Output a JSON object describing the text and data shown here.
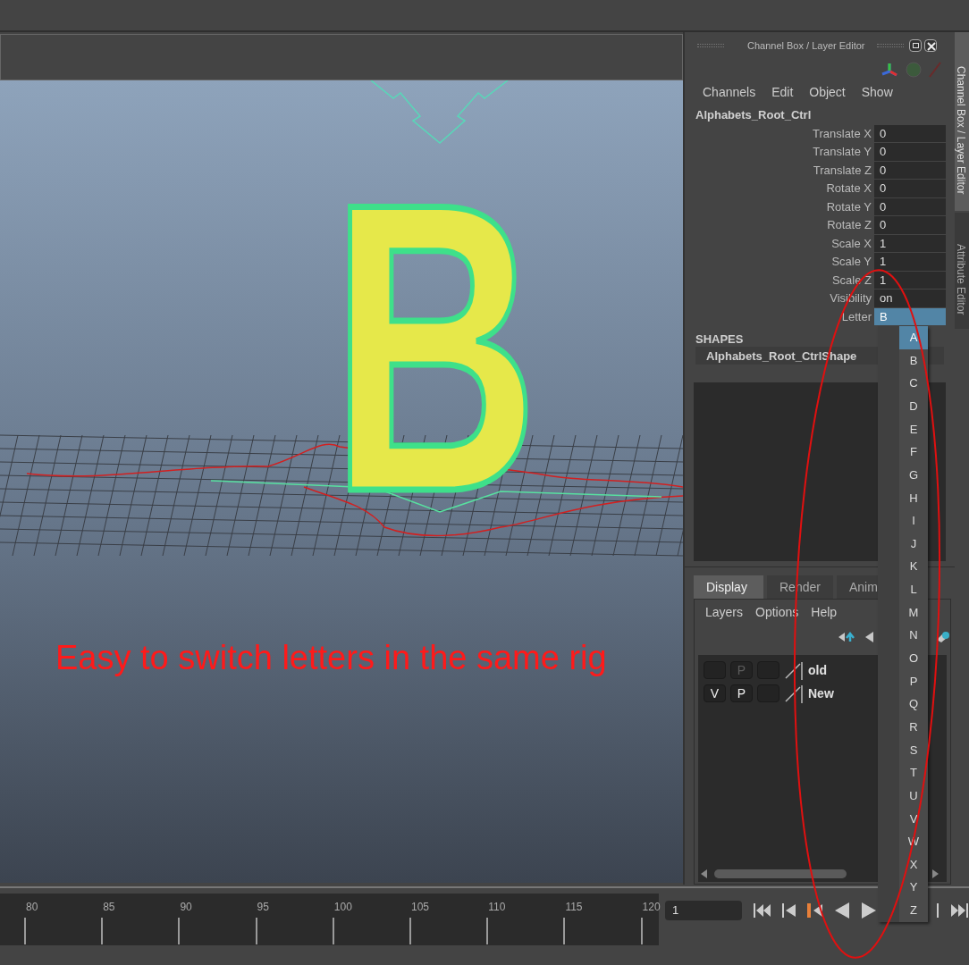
{
  "viewport": {
    "model_letter": "B",
    "annotation": "Easy to switch letters in the same rig"
  },
  "channel_box": {
    "title": "Channel Box / Layer Editor",
    "menus": [
      "Channels",
      "Edit",
      "Object",
      "Show"
    ],
    "node": "Alphabets_Root_Ctrl",
    "attributes": [
      {
        "label": "Translate X",
        "value": "0",
        "selected": false
      },
      {
        "label": "Translate Y",
        "value": "0",
        "selected": false
      },
      {
        "label": "Translate Z",
        "value": "0",
        "selected": false
      },
      {
        "label": "Rotate X",
        "value": "0",
        "selected": false
      },
      {
        "label": "Rotate Y",
        "value": "0",
        "selected": false
      },
      {
        "label": "Rotate Z",
        "value": "0",
        "selected": false
      },
      {
        "label": "Scale X",
        "value": "1",
        "selected": false
      },
      {
        "label": "Scale Y",
        "value": "1",
        "selected": false
      },
      {
        "label": "Scale Z",
        "value": "1",
        "selected": false
      },
      {
        "label": "Visibility",
        "value": "on",
        "selected": false
      },
      {
        "label": "Letter",
        "value": "B",
        "selected": true
      }
    ],
    "shapes_header": "SHAPES",
    "shape": "Alphabets_Root_CtrlShape"
  },
  "side_tabs": [
    {
      "label": "Channel Box / Layer Editor",
      "selected": true
    },
    {
      "label": "Attribute Editor",
      "selected": false
    }
  ],
  "letter_menu": [
    {
      "label": "A",
      "selected": true
    },
    {
      "label": "B",
      "selected": false
    },
    {
      "label": "C",
      "selected": false
    },
    {
      "label": "D",
      "selected": false
    },
    {
      "label": "E",
      "selected": false
    },
    {
      "label": "F",
      "selected": false
    },
    {
      "label": "G",
      "selected": false
    },
    {
      "label": "H",
      "selected": false
    },
    {
      "label": "I",
      "selected": false
    },
    {
      "label": "J",
      "selected": false
    },
    {
      "label": "K",
      "selected": false
    },
    {
      "label": "L",
      "selected": false
    },
    {
      "label": "M",
      "selected": false
    },
    {
      "label": "N",
      "selected": false
    },
    {
      "label": "O",
      "selected": false
    },
    {
      "label": "P",
      "selected": false
    },
    {
      "label": "Q",
      "selected": false
    },
    {
      "label": "R",
      "selected": false
    },
    {
      "label": "S",
      "selected": false
    },
    {
      "label": "T",
      "selected": false
    },
    {
      "label": "U",
      "selected": false
    },
    {
      "label": "V",
      "selected": false
    },
    {
      "label": "W",
      "selected": false
    },
    {
      "label": "X",
      "selected": false
    },
    {
      "label": "Y",
      "selected": false
    },
    {
      "label": "Z",
      "selected": false
    }
  ],
  "layer_editor": {
    "tabs": [
      {
        "label": "Display",
        "selected": true
      },
      {
        "label": "Render",
        "selected": false
      },
      {
        "label": "Anim",
        "selected": false
      }
    ],
    "menus": [
      "Layers",
      "Options",
      "Help"
    ],
    "layers": [
      {
        "name": "old",
        "p_label": "P",
        "p_on": false
      },
      {
        "name": "New",
        "v_label": "V",
        "p_label": "P",
        "p_on": true
      }
    ]
  },
  "timeline": {
    "ticks": [
      "80",
      "85",
      "90",
      "95",
      "100",
      "105",
      "110",
      "115",
      "120"
    ],
    "current_frame": "1"
  }
}
